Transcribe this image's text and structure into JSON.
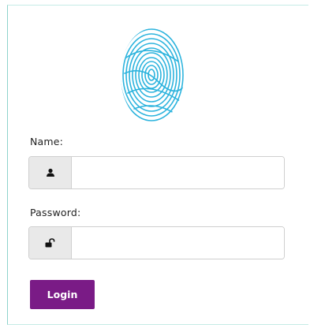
{
  "form": {
    "name_label": "Name:",
    "name_value": "",
    "password_label": "Password:",
    "password_value": "",
    "login_label": "Login"
  },
  "icons": {
    "fingerprint": "fingerprint-icon",
    "user": "user-icon",
    "password": "unlock-icon"
  },
  "colors": {
    "accent": "#7a1b86",
    "fingerprint": "#2bb3dd",
    "card_border": "#8fd3cb",
    "addon_bg": "#e9e9e9"
  }
}
